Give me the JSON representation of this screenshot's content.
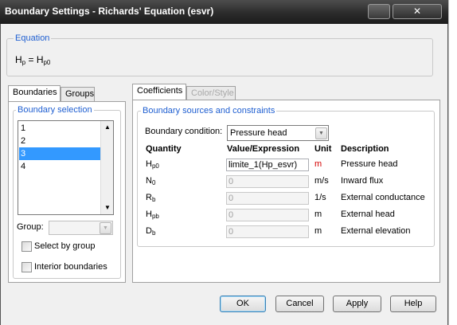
{
  "window": {
    "title": "Boundary Settings - Richards' Equation (esvr)",
    "close_glyph": "✕"
  },
  "equation": {
    "legend": "Equation",
    "lhs": "H",
    "lhs_sub": "p",
    "equals": " = ",
    "rhs": "H",
    "rhs_sub": "p0"
  },
  "left_tabs": [
    {
      "label": "Boundaries",
      "active": true
    },
    {
      "label": "Groups",
      "active": false
    }
  ],
  "boundary_selection": {
    "legend": "Boundary selection",
    "items": [
      "1",
      "2",
      "3",
      "4"
    ],
    "selected": "3"
  },
  "group": {
    "label": "Group:"
  },
  "checkboxes": {
    "select_by_group": "Select by group",
    "interior_boundaries": "Interior boundaries"
  },
  "right_tabs": [
    {
      "label": "Coefficients",
      "active": true
    },
    {
      "label": "Color/Style",
      "active": false,
      "disabled": true
    }
  ],
  "sources": {
    "legend": "Boundary sources and constraints",
    "condition_label": "Boundary condition:",
    "condition_value": "Pressure head",
    "headers": {
      "quantity": "Quantity",
      "value": "Value/Expression",
      "unit": "Unit",
      "description": "Description"
    },
    "rows": [
      {
        "q": "H",
        "q_sub": "p0",
        "value": "limite_1(Hp_esvr)",
        "unit": "m",
        "unit_color": "#d40000",
        "description": "Pressure head",
        "enabled": true
      },
      {
        "q": "N",
        "q_sub": "0",
        "value": "0",
        "unit": "m/s",
        "unit_color": "#000000",
        "description": "Inward flux",
        "enabled": false
      },
      {
        "q": "R",
        "q_sub": "b",
        "value": "0",
        "unit": "1/s",
        "unit_color": "#000000",
        "description": "External conductance",
        "enabled": false
      },
      {
        "q": "H",
        "q_sub": "pb",
        "value": "0",
        "unit": "m",
        "unit_color": "#000000",
        "description": "External head",
        "enabled": false
      },
      {
        "q": "D",
        "q_sub": "b",
        "value": "0",
        "unit": "m",
        "unit_color": "#000000",
        "description": "External elevation",
        "enabled": false
      }
    ]
  },
  "buttons": {
    "ok": "OK",
    "cancel": "Cancel",
    "apply": "Apply",
    "help": "Help"
  },
  "colors": {
    "accent": "#1f5fd1",
    "selection": "#3399ff",
    "titlebar": "#2b2b2b"
  }
}
